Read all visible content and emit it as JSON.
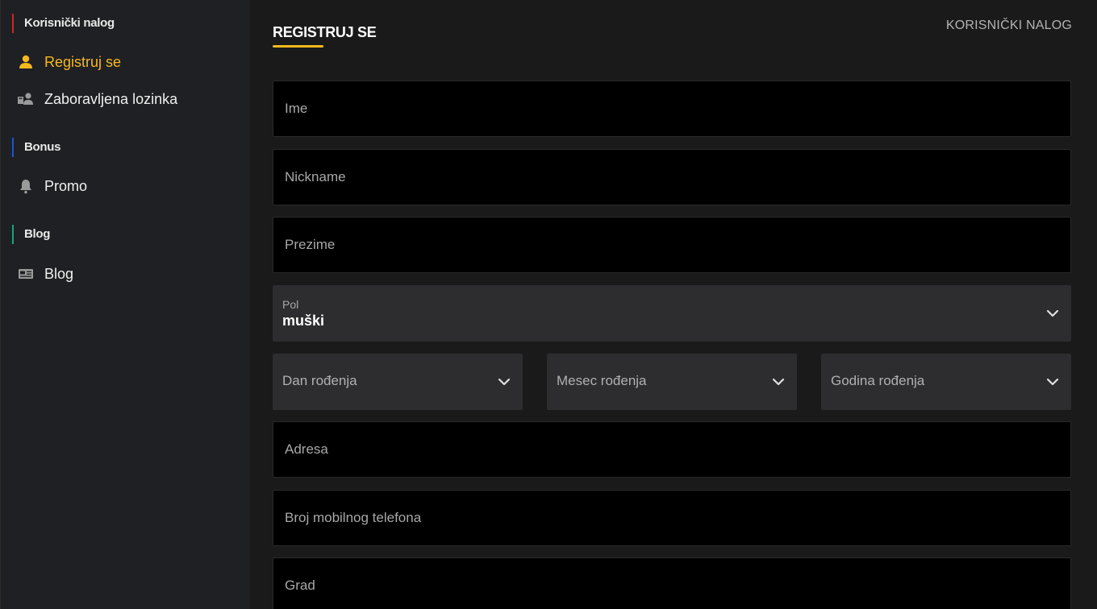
{
  "sidebar": {
    "sections": [
      {
        "title": "Korisnički nalog"
      },
      {
        "title": "Bonus"
      },
      {
        "title": "Blog"
      }
    ],
    "items": [
      {
        "label": "Registruj se",
        "icon": "user-icon",
        "active": true
      },
      {
        "label": "Zaboravljena lozinka",
        "icon": "users-icon"
      },
      {
        "label": "Promo",
        "icon": "bell-icon"
      },
      {
        "label": "Blog",
        "icon": "newspaper-icon"
      }
    ]
  },
  "main": {
    "title": "REGISTRUJ SE",
    "breadcrumb": "KORISNIČKI NALOG",
    "fields": {
      "ime": {
        "placeholder": "Ime"
      },
      "nickname": {
        "placeholder": "Nickname"
      },
      "prezime": {
        "placeholder": "Prezime"
      },
      "pol": {
        "label": "Pol",
        "value": "muški"
      },
      "dan": {
        "placeholder": "Dan rođenja"
      },
      "mesec": {
        "placeholder": "Mesec rođenja"
      },
      "godina": {
        "placeholder": "Godina rođenja"
      },
      "adresa": {
        "placeholder": "Adresa"
      },
      "telefon": {
        "placeholder": "Broj mobilnog telefona"
      },
      "grad": {
        "placeholder": "Grad"
      }
    }
  },
  "colors": {
    "accent": "#f5b91e",
    "sidebar_bg": "#1f2023",
    "main_bg": "#1a1a1a",
    "input_bg": "#000000",
    "select_bg": "#2d2d2f"
  }
}
